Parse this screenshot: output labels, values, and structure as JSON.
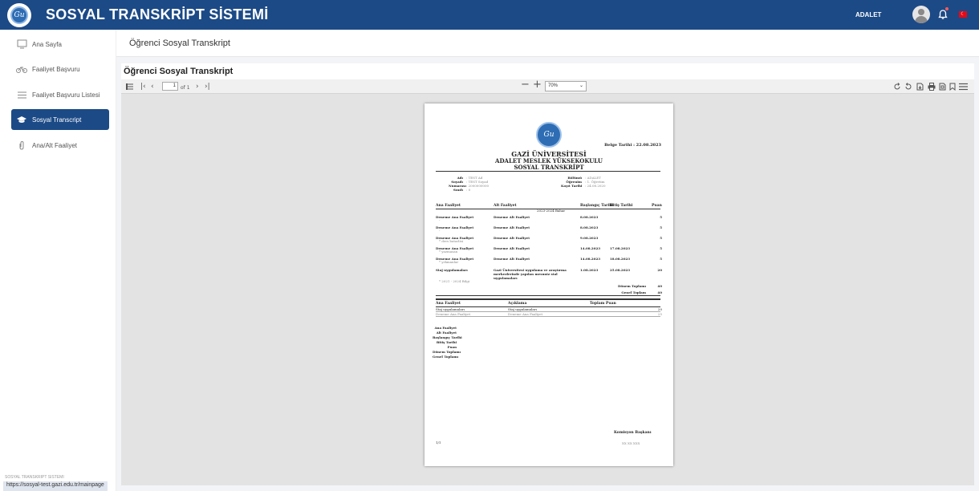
{
  "header": {
    "app_title": "SOSYAL TRANSKRİPT SİSTEMİ",
    "user_name": "ADALET",
    "flag_glyph": "☾"
  },
  "sidebar": {
    "items": [
      {
        "label": "Ana Sayfa",
        "icon": "monitor-icon"
      },
      {
        "label": "Faaliyet Başvuru",
        "icon": "bicycle-icon"
      },
      {
        "label": "Faaliyet Başvuru Listesi",
        "icon": "list-icon"
      },
      {
        "label": "Sosyal Transcript",
        "icon": "graduation-cap-icon"
      },
      {
        "label": "Ana/Alt Faaliyet",
        "icon": "paperclip-icon"
      }
    ],
    "active_index": 3
  },
  "status_url": "https://sosyal-test.gazi.edu.tr/mainpage",
  "footer_text": "SOSYAL TRANSKRIPT SISTEMI",
  "breadcrumb": "Öğrenci Sosyal Transkript",
  "card_title": "Öğrenci Sosyal Transkript",
  "viewer": {
    "page_number": "1",
    "page_count": "of 1",
    "zoom": "70%"
  },
  "document": {
    "seal_text": "Gu",
    "date_label": "Belge Tarihi : 22.08.2023",
    "university": "GAZİ ÜNİVERSİTESİ",
    "school": "ADALET MESLEK YÜKSEKOKULU",
    "doc_title": "SOSYAL TRANSKRİPT",
    "info_left": {
      "labels": [
        "Adı",
        "Soyadı",
        "Numarası",
        "Sınıfı"
      ],
      "values": [
        ": TEST Ad",
        ": TEST Soyad",
        ": 2000000000",
        ": 0"
      ]
    },
    "info_right": {
      "labels": [
        "Bölümü",
        "Öğrenim",
        "Kayıt Tarihi"
      ],
      "values": [
        ": ADALET",
        ": 1. Öğretim",
        ": 24.08.2020"
      ]
    },
    "table_headers": [
      "Ana Faaliyet",
      "Alt Faaliyet",
      "Başlangıç Tarihi",
      "Bitiş Tarihi",
      "Puan"
    ],
    "term_label": "2023-2024 Bahar",
    "rows": [
      {
        "ana": "Deneme Ana Faaliyet",
        "note": "-",
        "alt": "Deneme Alt Faaliyet",
        "start": "8.08.2023",
        "end": "",
        "puan": "5"
      },
      {
        "ana": "Deneme Ana Faaliyet",
        "note": "-",
        "alt": "Deneme Alt Faaliyet",
        "start": "8.08.2023",
        "end": "",
        "puan": "5"
      },
      {
        "ana": "Deneme Ana Faaliyet",
        "note": "* ders batarlisi",
        "alt": "Deneme Alt Faaliyet",
        "start": "9.08.2023",
        "end": "",
        "puan": "5"
      },
      {
        "ana": "Deneme Ana Faaliyet",
        "note": "* yazmasan",
        "alt": "Deneme Alt Faaliyet",
        "start": "14.08.2023",
        "end": "17.08.2023",
        "puan": "5"
      },
      {
        "ana": "Deneme Ana Faaliyet",
        "note": "* yrkmanlar",
        "alt": "Deneme Alt Faaliyet",
        "start": "14.08.2023",
        "end": "18.08.2023",
        "puan": "5"
      },
      {
        "ana": "Staj uygulamaları",
        "note": "",
        "alt": "Gazi Üniversitesi uygulama ve araştırma merkezlerinde yapılan mesuniz stal uygulamaları",
        "start": "1.08.2023",
        "end": "25.08.2023",
        "puan": "20"
      }
    ],
    "prev_term": "* 2021 - 2024 Bilgi",
    "donem_label": "Dönem Toplamı",
    "donem_total": "40",
    "genel_label": "Genel Toplam",
    "genel_total": "40",
    "summary_headers": [
      "Ana Faaliyet",
      "Açıklama",
      "Toplam Puan"
    ],
    "summary_rows": [
      {
        "ana": "Staj uygulamaları",
        "aciklama": "Staj uygulamaları",
        "puan": "20"
      },
      {
        "ana": "Deneme Ana Faaliyet",
        "aciklama": "Deneme Ana Faaliyet",
        "puan": "25"
      }
    ],
    "legend_labels": [
      "Ana Faaliyet",
      "Alt Faaliyet",
      "Başlangıç Tarihi",
      "Bitiş Tarihi",
      "Puan",
      "Dönem Toplamı",
      "Genel Toplamı"
    ],
    "page_indicator": "1/1",
    "signer_title": "Komisyon Başkanı",
    "signer_sub": "XX XX XXX"
  }
}
